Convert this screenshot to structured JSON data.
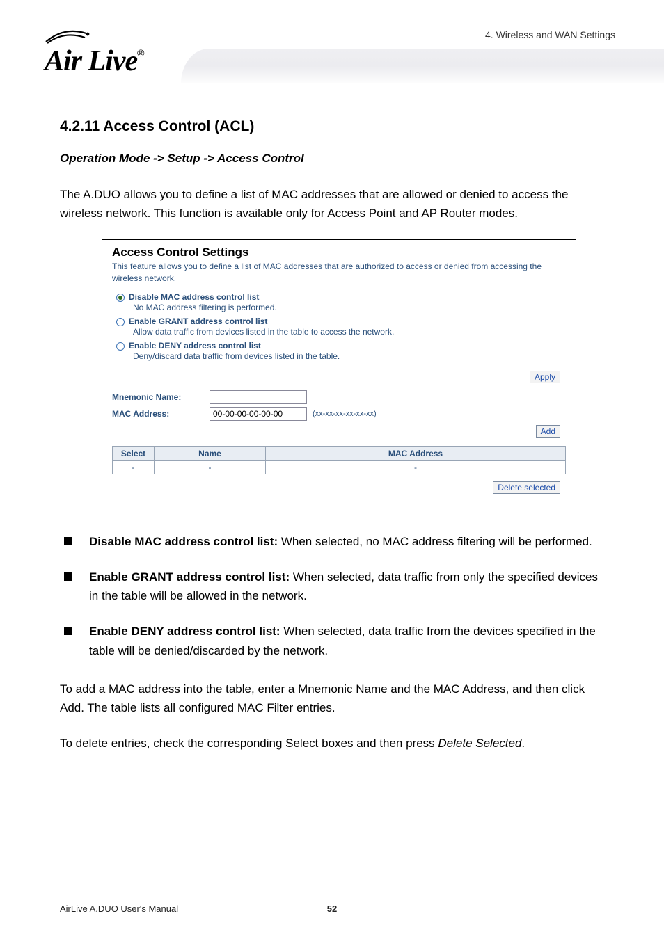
{
  "header": {
    "chapter_label": "4. Wireless and WAN Settings",
    "logo_text": "Air Live",
    "logo_mark": "®"
  },
  "section": {
    "heading": "4.2.11 Access Control (ACL)",
    "breadcrumb": "Operation Mode -> Setup -> Access Control",
    "intro": "The A.DUO allows you to define a list of MAC addresses that are allowed or denied to access the wireless network. This function is available only for Access Point and AP Router modes."
  },
  "panel": {
    "title": "Access Control Settings",
    "description": "This feature allows you to define a list of MAC addresses that are authorized to access or denied from accessing the wireless network.",
    "radios": [
      {
        "label": "Disable MAC address control list",
        "sub": "No MAC address filtering is performed.",
        "selected": true
      },
      {
        "label": "Enable GRANT address control list",
        "sub": "Allow data traffic from devices listed in the table to access the network.",
        "selected": false
      },
      {
        "label": "Enable DENY address control list",
        "sub": "Deny/discard data traffic from devices listed in the table.",
        "selected": false
      }
    ],
    "apply_label": "Apply",
    "mnemonic_label": "Mnemonic Name:",
    "mnemonic_value": "",
    "mac_label": "MAC Address:",
    "mac_value": "00-00-00-00-00-00",
    "mac_hint": "(xx-xx-xx-xx-xx-xx)",
    "add_label": "Add",
    "table_headers": [
      "Select",
      "Name",
      "MAC Address"
    ],
    "table_row": [
      "-",
      "-",
      "-"
    ],
    "delete_label": "Delete selected"
  },
  "bullets": [
    {
      "bold": "Disable MAC address control list:",
      "rest": " When selected, no MAC address filtering will be performed."
    },
    {
      "bold": "Enable GRANT address control list:",
      "rest": " When selected, data traffic from only the specified devices in the table will be allowed in the network."
    },
    {
      "bold": "Enable DENY address control list:",
      "rest": " When selected, data traffic from the devices specified in the table will be denied/discarded by the network."
    }
  ],
  "post": {
    "p1": "To add a MAC address into the table, enter a Mnemonic Name and the MAC Address, and then click Add. The table lists all configured MAC Filter entries.",
    "p2_a": "To delete entries, check the corresponding Select boxes and then press ",
    "p2_i": "Delete Selected",
    "p2_b": "."
  },
  "footer": {
    "manual": "AirLive A.DUO User's Manual",
    "page": "52"
  }
}
